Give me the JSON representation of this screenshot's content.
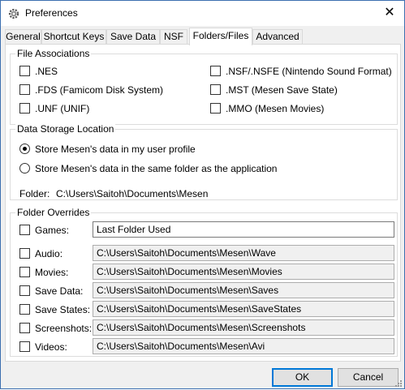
{
  "window": {
    "title": "Preferences"
  },
  "tabs": [
    {
      "label": "General"
    },
    {
      "label": "Shortcut Keys"
    },
    {
      "label": "Save Data"
    },
    {
      "label": "NSF"
    },
    {
      "label": "Folders/Files"
    },
    {
      "label": "Advanced"
    }
  ],
  "file_associations": {
    "title": "File Associations",
    "items": [
      {
        "label": ".NES",
        "checked": false
      },
      {
        "label": ".NSF/.NSFE (Nintendo Sound Format)",
        "checked": false
      },
      {
        "label": ".FDS (Famicom Disk System)",
        "checked": false
      },
      {
        "label": ".MST (Mesen Save State)",
        "checked": false
      },
      {
        "label": ".UNF (UNIF)",
        "checked": false
      },
      {
        "label": ".MMO (Mesen Movies)",
        "checked": false
      }
    ]
  },
  "data_storage": {
    "title": "Data Storage Location",
    "options": [
      {
        "label": "Store Mesen's data in my user profile",
        "selected": true
      },
      {
        "label": "Store Mesen's data in the same folder as the application",
        "selected": false
      }
    ],
    "folder_label": "Folder:",
    "folder_path": "C:\\Users\\Saitoh\\Documents\\Mesen"
  },
  "folder_overrides": {
    "title": "Folder Overrides",
    "items": [
      {
        "label": "Games:",
        "path": "Last Folder Used",
        "checked": false
      },
      {
        "label": "Audio:",
        "path": "C:\\Users\\Saitoh\\Documents\\Mesen\\Wave",
        "checked": false
      },
      {
        "label": "Movies:",
        "path": "C:\\Users\\Saitoh\\Documents\\Mesen\\Movies",
        "checked": false
      },
      {
        "label": "Save Data:",
        "path": "C:\\Users\\Saitoh\\Documents\\Mesen\\Saves",
        "checked": false
      },
      {
        "label": "Save States:",
        "path": "C:\\Users\\Saitoh\\Documents\\Mesen\\SaveStates",
        "checked": false
      },
      {
        "label": "Screenshots:",
        "path": "C:\\Users\\Saitoh\\Documents\\Mesen\\Screenshots",
        "checked": false
      },
      {
        "label": "Videos:",
        "path": "C:\\Users\\Saitoh\\Documents\\Mesen\\Avi",
        "checked": false
      }
    ]
  },
  "buttons": {
    "ok": "OK",
    "cancel": "Cancel"
  },
  "colors": {
    "accent": "#0078d7",
    "border": "#dcdcdc",
    "panel": "#f0f0f0"
  }
}
